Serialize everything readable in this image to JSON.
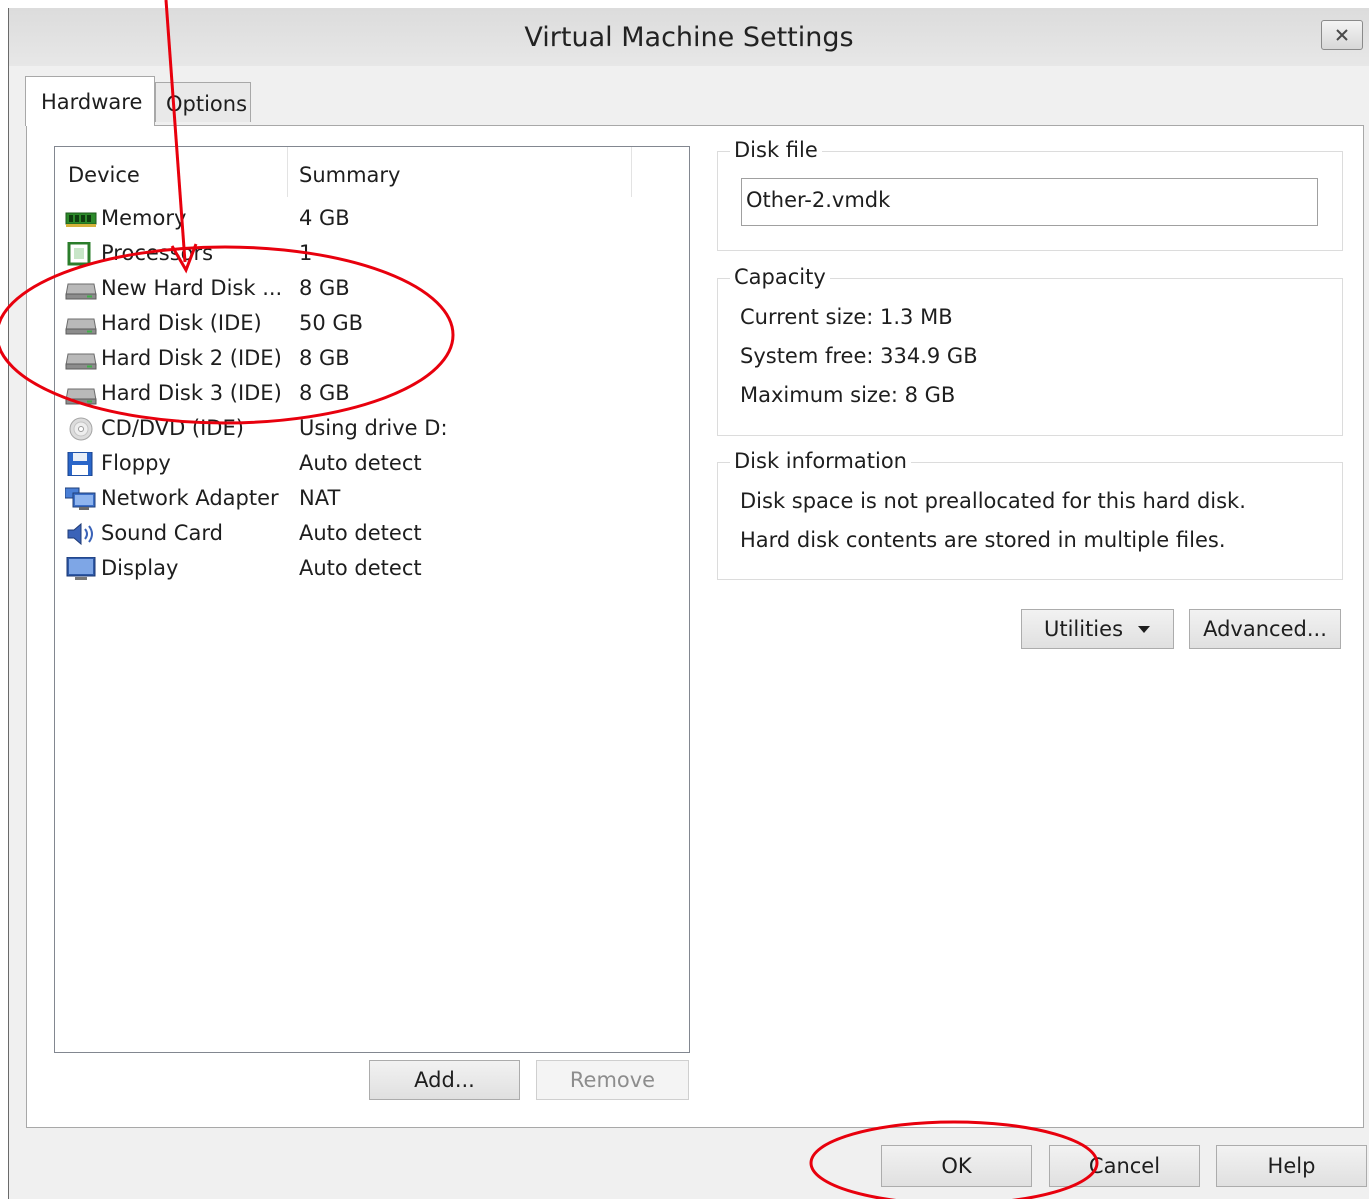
{
  "window": {
    "title": "Virtual Machine Settings"
  },
  "tabs": [
    {
      "label": "Hardware",
      "selected": true
    },
    {
      "label": "Options",
      "selected": false
    }
  ],
  "device_list": {
    "columns": [
      "Device",
      "Summary"
    ],
    "rows": [
      {
        "icon": "memory-icon",
        "device": "Memory",
        "summary": "4 GB"
      },
      {
        "icon": "processor-icon",
        "device": "Processors",
        "summary": "1"
      },
      {
        "icon": "hard-disk-icon",
        "device": "New Hard Disk ...",
        "summary": "8 GB"
      },
      {
        "icon": "hard-disk-icon",
        "device": "Hard Disk (IDE)",
        "summary": "50 GB"
      },
      {
        "icon": "hard-disk-icon",
        "device": "Hard Disk 2 (IDE)",
        "summary": "8 GB"
      },
      {
        "icon": "hard-disk-icon",
        "device": "Hard Disk 3 (IDE)",
        "summary": "8 GB"
      },
      {
        "icon": "cd-dvd-icon",
        "device": "CD/DVD (IDE)",
        "summary": "Using drive D:"
      },
      {
        "icon": "floppy-icon",
        "device": "Floppy",
        "summary": "Auto detect"
      },
      {
        "icon": "network-adapter-icon",
        "device": "Network Adapter",
        "summary": "NAT"
      },
      {
        "icon": "sound-card-icon",
        "device": "Sound Card",
        "summary": "Auto detect"
      },
      {
        "icon": "display-icon",
        "device": "Display",
        "summary": "Auto detect"
      }
    ],
    "add_label": "Add...",
    "remove_label": "Remove"
  },
  "disk_file": {
    "legend": "Disk file",
    "value": "Other-2.vmdk"
  },
  "capacity": {
    "legend": "Capacity",
    "current_size": "Current size:  1.3 MB",
    "system_free": "System free:  334.9 GB",
    "maximum_size": "Maximum size:  8 GB"
  },
  "disk_information": {
    "legend": "Disk information",
    "line1": "Disk space is not preallocated for this hard disk.",
    "line2": "Hard disk contents are stored in multiple files."
  },
  "disk_buttons": {
    "utilities_label": "Utilities",
    "advanced_label": "Advanced..."
  },
  "footer": {
    "ok_label": "OK",
    "cancel_label": "Cancel",
    "help_label": "Help"
  },
  "annotation": {
    "color": "#e8000d"
  }
}
